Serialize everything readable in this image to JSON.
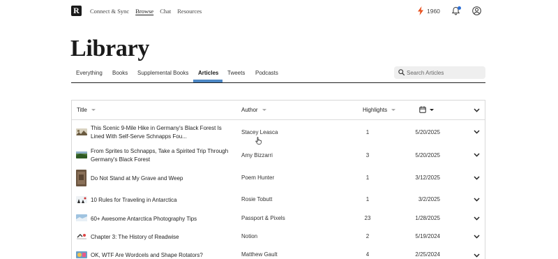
{
  "nav": {
    "logo": "R",
    "links": [
      "Connect & Sync",
      "Browse",
      "Chat",
      "Resources"
    ],
    "active_link": "Browse",
    "streak_count": "1960",
    "streak_color": "#e8501e",
    "notification_color": "#2c6ed5"
  },
  "page": {
    "title": "Library"
  },
  "tabs": {
    "items": [
      "Everything",
      "Books",
      "Supplemental Books",
      "Articles",
      "Tweets",
      "Podcasts"
    ],
    "active": "Articles",
    "accent_color": "#4b86c4"
  },
  "search": {
    "placeholder": "Search Articles"
  },
  "table": {
    "columns": {
      "title": "Title",
      "author": "Author",
      "highlights": "Highlights",
      "date_icon": "calendar-icon"
    },
    "rows": [
      {
        "title": "This Scenic 9-Mile Hike in Germany's Black Forest Is Lined With Self-Serve Schnapps Fou...",
        "author": "Stacey Leasca",
        "highlights": "1",
        "date": "5/20/2025"
      },
      {
        "title": "From Sprites to Schnapps, Take a Spirited Trip Through Germany's Black Forest",
        "author": "Amy Bizzarri",
        "highlights": "3",
        "date": "5/20/2025"
      },
      {
        "title": "Do Not Stand at My Grave and Weep",
        "author": "Poem Hunter",
        "highlights": "1",
        "date": "3/12/2025"
      },
      {
        "title": "10 Rules for Traveling in Antarctica",
        "author": "Rosie Tobutt",
        "highlights": "1",
        "date": "3/2/2025"
      },
      {
        "title": "60+ Awesome Antarctica Photography Tips",
        "author": "Passport & Pixels",
        "highlights": "23",
        "date": "1/28/2025"
      },
      {
        "title": "Chapter 3: The History of Readwise",
        "author": "Notion",
        "highlights": "2",
        "date": "5/19/2024"
      },
      {
        "title": "OK, WTF Are Wordcels and Shape Rotators?",
        "author": "Matthew Gault",
        "highlights": "4",
        "date": "2/25/2024"
      }
    ]
  }
}
